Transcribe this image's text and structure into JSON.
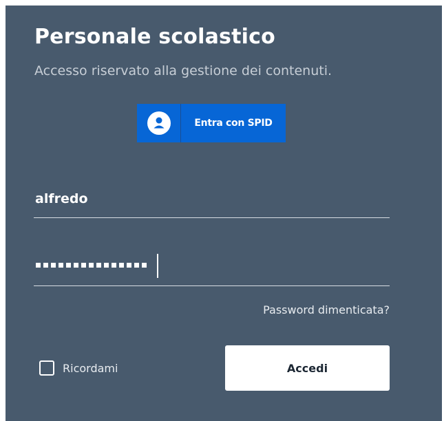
{
  "header": {
    "title": "Personale scolastico",
    "subtitle": "Accesso riservato alla gestione dei contenuti."
  },
  "spid": {
    "label": "Entra con SPID",
    "icon": "user-circle-icon"
  },
  "form": {
    "username_value": "alfredo",
    "password_dot_count": 15,
    "forgot_label": "Password dimenticata?",
    "remember_label": "Ricordami",
    "remember_checked": false,
    "submit_label": "Accedi"
  },
  "colors": {
    "panel_bg": "#485a6d",
    "spid_blue": "#0766d6",
    "text": "#ffffff"
  }
}
